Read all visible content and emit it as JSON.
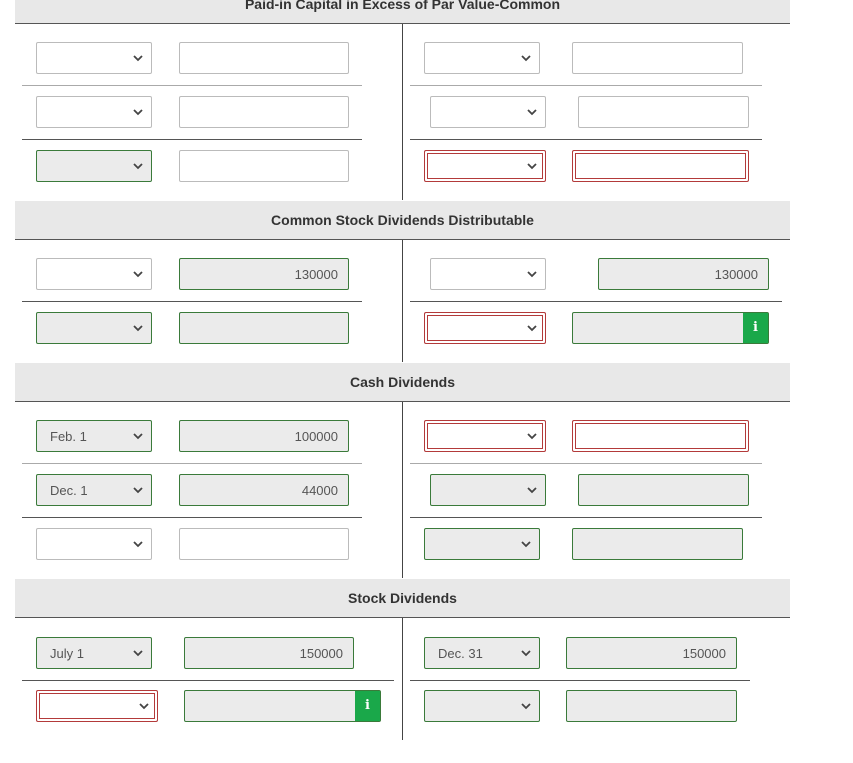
{
  "sections": {
    "paid_in_capital": {
      "title": "Paid-in Capital in Excess of Par Value-Common"
    },
    "dividends_distributable": {
      "title": "Common Stock Dividends Distributable",
      "debit_amount": "130000",
      "credit_amount": "130000"
    },
    "cash_dividends": {
      "title": "Cash Dividends",
      "row1_date": "Feb. 1",
      "row1_amount": "100000",
      "row2_date": "Dec. 1",
      "row2_amount": "44000"
    },
    "stock_dividends": {
      "title": "Stock Dividends",
      "debit_date": "July 1",
      "debit_amount": "150000",
      "credit_date": "Dec. 31",
      "credit_amount": "150000"
    }
  },
  "icons": {
    "info": "i",
    "chevron": "chevron-down-icon"
  },
  "colors": {
    "correct_border": "#3a7a3a",
    "error_border": "#b33a3a",
    "info_green": "#1aa84a",
    "header_bg": "#e8e8e8"
  }
}
